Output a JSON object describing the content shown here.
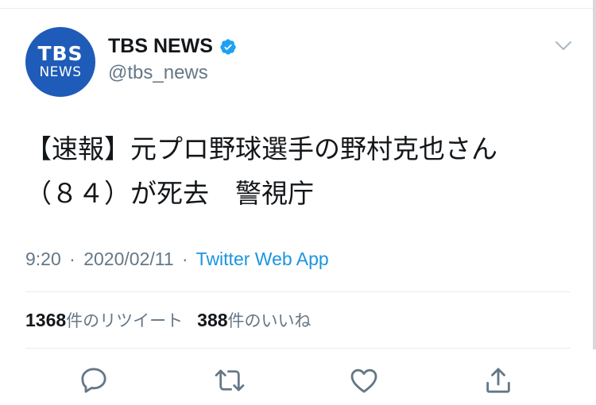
{
  "account": {
    "avatar_top": "TBS",
    "avatar_bottom": "NEWS",
    "display_name": "TBS NEWS",
    "handle": "@tbs_news",
    "verified": true
  },
  "tweet": {
    "line1": "【速報】元プロ野球選手の野村克也さん",
    "line2": "（８４）が死去　警視庁"
  },
  "meta": {
    "time": "9:20",
    "date": "2020/02/11",
    "separator": "·",
    "source": "Twitter Web App"
  },
  "stats": {
    "retweet_count": "1368",
    "retweet_label": "件のリツイート",
    "like_count": "388",
    "like_label": "件のいいね"
  },
  "icons": {
    "menu": "chevron-down-icon",
    "reply": "reply-icon",
    "retweet": "retweet-icon",
    "like": "heart-icon",
    "share": "share-icon",
    "verified": "verified-badge-icon"
  },
  "colors": {
    "avatar_bg": "#1f5bb8",
    "verified": "#1da1f2",
    "link": "#1b95e0",
    "secondary_text": "#657786",
    "icon": "#657786"
  }
}
